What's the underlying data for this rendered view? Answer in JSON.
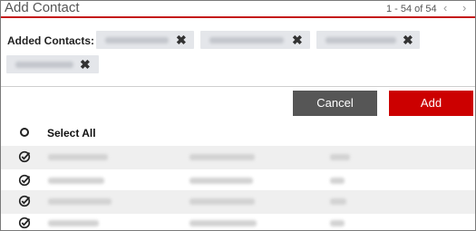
{
  "header": {
    "title": "Add Contact",
    "pager_text": "1 - 54 of 54",
    "prev_icon": "‹",
    "next_icon": "›"
  },
  "added_contacts": {
    "label": "Added Contacts:",
    "remove_icon": "✖"
  },
  "actions": {
    "cancel_label": "Cancel",
    "add_label": "Add"
  },
  "list": {
    "select_all_label": "Select All"
  },
  "colors": {
    "accent": "#cc0000",
    "cancel_bg": "#565656",
    "chip_bg": "#e4e6ea"
  }
}
